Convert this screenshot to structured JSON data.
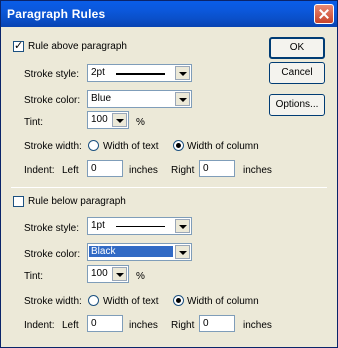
{
  "window": {
    "title": "Paragraph Rules"
  },
  "buttons": {
    "ok": "OK",
    "cancel": "Cancel",
    "options": "Options..."
  },
  "labels": {
    "stroke_style": "Stroke style:",
    "stroke_color": "Stroke color:",
    "tint": "Tint:",
    "percent": "%",
    "stroke_width": "Stroke width:",
    "width_of_text": "Width of text",
    "width_of_column": "Width of column",
    "indent": "Indent:",
    "left": "Left",
    "right": "Right",
    "inches": "inches"
  },
  "above": {
    "checkbox_label": "Rule above paragraph",
    "checked": true,
    "stroke_style": "2pt",
    "stroke_color": "Blue",
    "tint": "100",
    "stroke_width_selected": "Width of column",
    "indent_left": "0",
    "indent_right": "0"
  },
  "below": {
    "checkbox_label": "Rule below paragraph",
    "checked": false,
    "stroke_style": "1pt",
    "stroke_color": "Black",
    "tint": "100",
    "stroke_width_selected": "Width of column",
    "indent_left": "0",
    "indent_right": "0"
  },
  "colors": {
    "titlebar": "#0a5de8",
    "selection": "#316ac5",
    "dialog_bg": "#ece9d8"
  }
}
